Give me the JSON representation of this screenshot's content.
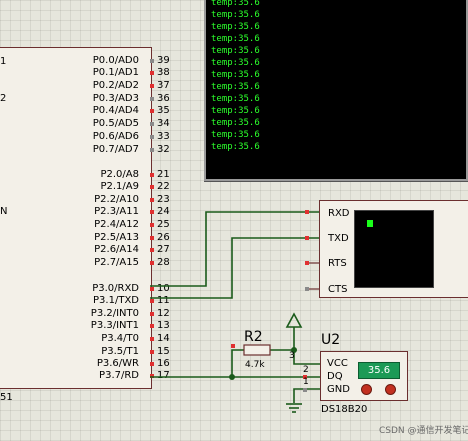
{
  "terminal": {
    "lines": [
      "temp:35.6",
      "temp:35.6",
      "temp:35.6",
      "temp:35.6",
      "temp:35.6",
      "temp:35.6",
      "temp:35.6",
      "temp:35.6",
      "temp:35.6",
      "temp:35.6",
      "temp:35.6",
      "temp:35.6",
      "temp:35.6"
    ]
  },
  "mcu": {
    "side_labels": [
      "1",
      "2",
      "N"
    ],
    "bottom_label": "51",
    "pins": [
      {
        "label": "P0.0/AD0",
        "num": "39",
        "dot": "gray"
      },
      {
        "label": "P0.1/AD1",
        "num": "38",
        "dot": "red"
      },
      {
        "label": "P0.2/AD2",
        "num": "37",
        "dot": "red"
      },
      {
        "label": "P0.3/AD3",
        "num": "36",
        "dot": "gray"
      },
      {
        "label": "P0.4/AD4",
        "num": "35",
        "dot": "red"
      },
      {
        "label": "P0.5/AD5",
        "num": "34",
        "dot": "gray"
      },
      {
        "label": "P0.6/AD6",
        "num": "33",
        "dot": "gray"
      },
      {
        "label": "P0.7/AD7",
        "num": "32",
        "dot": "gray"
      },
      {
        "label": "P2.0/A8",
        "num": "21",
        "dot": "red"
      },
      {
        "label": "P2.1/A9",
        "num": "22",
        "dot": "red"
      },
      {
        "label": "P2.2/A10",
        "num": "23",
        "dot": "red"
      },
      {
        "label": "P2.3/A11",
        "num": "24",
        "dot": "red"
      },
      {
        "label": "P2.4/A12",
        "num": "25",
        "dot": "red"
      },
      {
        "label": "P2.5/A13",
        "num": "26",
        "dot": "red"
      },
      {
        "label": "P2.6/A14",
        "num": "27",
        "dot": "red"
      },
      {
        "label": "P2.7/A15",
        "num": "28",
        "dot": "red"
      },
      {
        "label": "P3.0/RXD",
        "num": "10",
        "dot": "red"
      },
      {
        "label": "P3.1/TXD",
        "num": "11",
        "dot": "red"
      },
      {
        "label": "P3.2/INT0",
        "num": "12",
        "dot": "red"
      },
      {
        "label": "P3.3/INT1",
        "num": "13",
        "dot": "red"
      },
      {
        "label": "P3.4/T0",
        "num": "14",
        "dot": "red"
      },
      {
        "label": "P3.5/T1",
        "num": "15",
        "dot": "red"
      },
      {
        "label": "P3.6/WR",
        "num": "16",
        "dot": "red"
      },
      {
        "label": "P3.7/RD",
        "num": "17",
        "dot": "red"
      }
    ]
  },
  "uart": {
    "pins": [
      "RXD",
      "TXD",
      "RTS",
      "CTS"
    ]
  },
  "resistor": {
    "ref": "R2",
    "value": "4.7k"
  },
  "sensor": {
    "ref": "U2",
    "part": "DS18B20",
    "reading": "35.6",
    "pins": [
      "VCC",
      "DQ",
      "GND"
    ],
    "pin_numbers": [
      "3",
      "2",
      "1"
    ]
  },
  "watermark": "CSDN @通信开发笔记"
}
